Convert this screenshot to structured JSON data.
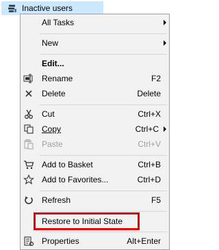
{
  "tree": {
    "selected_node_label": "Inactive users",
    "node_icon": "user-group-icon"
  },
  "context_menu": {
    "items": [
      {
        "label": "All Tasks",
        "shortcut": "",
        "submenu": true,
        "icon": ""
      },
      {
        "label": "New",
        "shortcut": "",
        "submenu": true,
        "icon": ""
      },
      {
        "label": "Edit...",
        "shortcut": "",
        "bold": true,
        "icon": ""
      },
      {
        "label": "Rename",
        "shortcut": "F2",
        "icon": "rename-icon"
      },
      {
        "label": "Delete",
        "shortcut": "Delete",
        "icon": "delete-icon"
      },
      {
        "label": "Cut",
        "shortcut": "Ctrl+X",
        "icon": "cut-icon"
      },
      {
        "label": "Copy",
        "shortcut": "Ctrl+C",
        "submenu": true,
        "icon": "copy-icon"
      },
      {
        "label": "Paste",
        "shortcut": "Ctrl+V",
        "disabled": true,
        "icon": "paste-icon"
      },
      {
        "label": "Add to Basket",
        "shortcut": "Ctrl+B",
        "icon": "basket-icon"
      },
      {
        "label": "Add to Favorites...",
        "shortcut": "Ctrl+D",
        "icon": "star-icon"
      },
      {
        "label": "Refresh",
        "shortcut": "F5",
        "icon": "refresh-icon"
      },
      {
        "label": "Restore to Initial State",
        "shortcut": "",
        "icon": "",
        "highlighted": true
      },
      {
        "label": "Properties",
        "shortcut": "Alt+Enter",
        "icon": "properties-icon"
      }
    ]
  },
  "colors": {
    "selection_background": "#cce8ff",
    "menu_background": "#f2f2f2",
    "highlight_border": "#e00000",
    "disabled_text": "#a0a0a0"
  }
}
